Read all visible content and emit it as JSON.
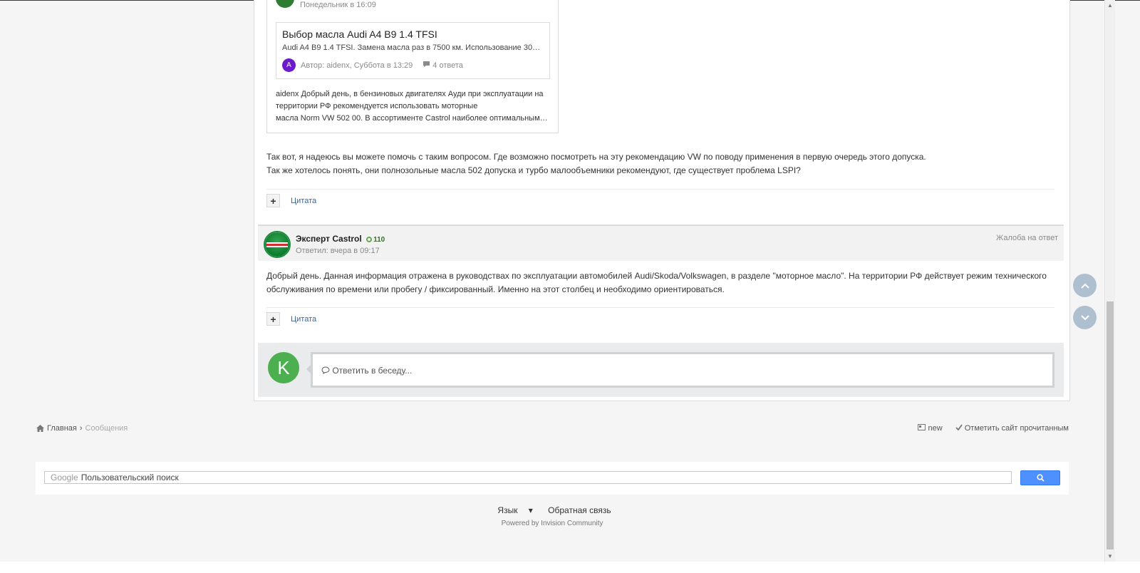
{
  "embed": {
    "header_date": "Понедельник в 16:09",
    "topic_title": "Выбор масла Audi A4 B9 1.4 TFSI",
    "topic_excerpt": "Audi A4 B9 1.4 TFSI. Замена масла раз в 7500 км. Использование 30% т...",
    "author_letter": "A",
    "author_meta": "Автор: aidenx, Суббота в 13:29",
    "replies": "4 ответа",
    "text_line1": "aidenx Добрый день, в бензиновых двигателях Ауди при эксплуатации на",
    "text_line2": "территории РФ рекомендуется использовать моторные",
    "text_line3": "масла Norm VW 502 00. В ассортименте Castrol наиболее оптимальным ва..."
  },
  "post1": {
    "line1": "Так вот, я надеюсь вы можете помочь с таким вопросом. Где возможно посмотреть на эту рекомендацию VW по поводу применения в первую очередь этого допуска.",
    "line2": "Так же хотелось понять, они полнозольные масла 502 допуска и турбо малообъемники рекомендуют, где существует проблема LSPI?",
    "plus": "+",
    "quote": "Цитата"
  },
  "reply": {
    "author": "Эксперт Castrol",
    "reputation": "110",
    "date": "Ответил: вчера в 09:17",
    "report": "Жалоба на ответ",
    "line1": "Добрый день. Данная информация отражена в руководствах по эксплуатации автомобилей Audi/Skoda/Volkswagen, в разделе \"моторное масло\". На территории РФ действует режим технического",
    "line2": "обслуживания по времени или пробегу / фиксированный. Именно на этот столбец и необходимо ориентироваться.",
    "plus": "+",
    "quote": "Цитата"
  },
  "reply_box": {
    "avatar_letter": "K",
    "placeholder": "Ответить в беседу..."
  },
  "breadcrumb": {
    "home": "Главная",
    "current": "Сообщения"
  },
  "actions": {
    "new": "new",
    "mark_read": "Отметить сайт прочитанным"
  },
  "search": {
    "google": "Google",
    "placeholder": "Пользовательский поиск"
  },
  "footer": {
    "language": "Язык",
    "feedback": "Обратная связь",
    "powered": "Powered by Invision Community"
  }
}
